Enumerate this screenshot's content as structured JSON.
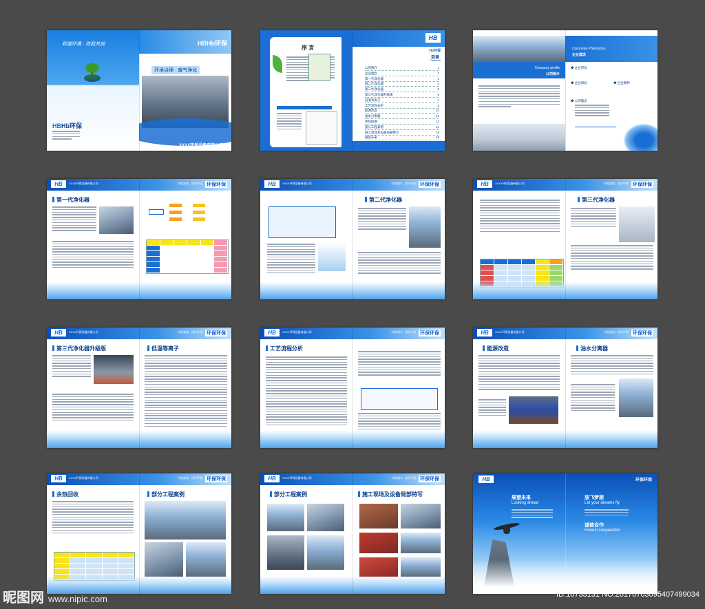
{
  "brand": {
    "logo": "HB",
    "name": "Hb环保",
    "brand_tag": "环保环保",
    "company_cn": "XXXX环保设备有限公司",
    "company_en": "XX XIANMAN SHEBEI CO.,LTD.",
    "header_strip": "XXXX环保设备有限公司",
    "header_tagline": "节能减排，保护环境"
  },
  "cover": {
    "slogan": "和谐环境 · 你我共创",
    "motto": "环境治理 · 废气净化"
  },
  "preface": {
    "title": "序 言"
  },
  "toc": {
    "title": "目录",
    "title_en": "Contents",
    "items": [
      {
        "label": "公司简介",
        "page": "1"
      },
      {
        "label": "企业理念",
        "page": "2"
      },
      {
        "label": "第一代净化器",
        "page": "3"
      },
      {
        "label": "第二代净化器",
        "page": "4"
      },
      {
        "label": "第三代净化器",
        "page": "5"
      },
      {
        "label": "第三代净化器升级版",
        "page": "6"
      },
      {
        "label": "低温等离子",
        "page": "7"
      },
      {
        "label": "工艺流程分析",
        "page": "8"
      },
      {
        "label": "能源改造",
        "page": "10"
      },
      {
        "label": "油水分离器",
        "page": "12"
      },
      {
        "label": "余热回收",
        "page": "13"
      },
      {
        "label": "部分工程案例",
        "page": "14"
      },
      {
        "label": "施工现场及设备局部特写",
        "page": "15"
      },
      {
        "label": "展望未来",
        "page": "19"
      }
    ]
  },
  "company": {
    "profile_en": "Company profile",
    "profile_cn": "公司简介",
    "philosophy_en": "Corporate Philosophy",
    "philosophy_cn": "企业理念",
    "items": [
      {
        "label": "企业宗旨"
      },
      {
        "label": "企业精神"
      },
      {
        "label": "企业目标"
      },
      {
        "label": "公司理念"
      }
    ]
  },
  "pages": {
    "gen1": "第一代净化器",
    "gen2": "第二代净化器",
    "gen3": "第三代净化器",
    "gen3_up": "第三代净化器升级版",
    "plasma": "低温等离子",
    "process": "工艺流程分析",
    "energy": "能源改造",
    "oil": "油水分离器",
    "heat": "余热回收",
    "cases": "部分工程案例",
    "site": "施工现场及设备局部特写"
  },
  "back": {
    "future_cn": "展望未来",
    "future_en": "Looking ahead",
    "dream_cn": "放飞梦想",
    "dream_en": "Let your dreams fly",
    "coop_cn": "诚信合作",
    "coop_en": "Honest cooperation"
  },
  "watermark": {
    "left": "昵图网",
    "url": "www.nipic.com",
    "right": "ID:10733131 NO:20170703095407499034"
  },
  "colors": {
    "accent": "#1b6fd4",
    "dark": "#0a3f8c",
    "background": "#4a4a4a"
  }
}
